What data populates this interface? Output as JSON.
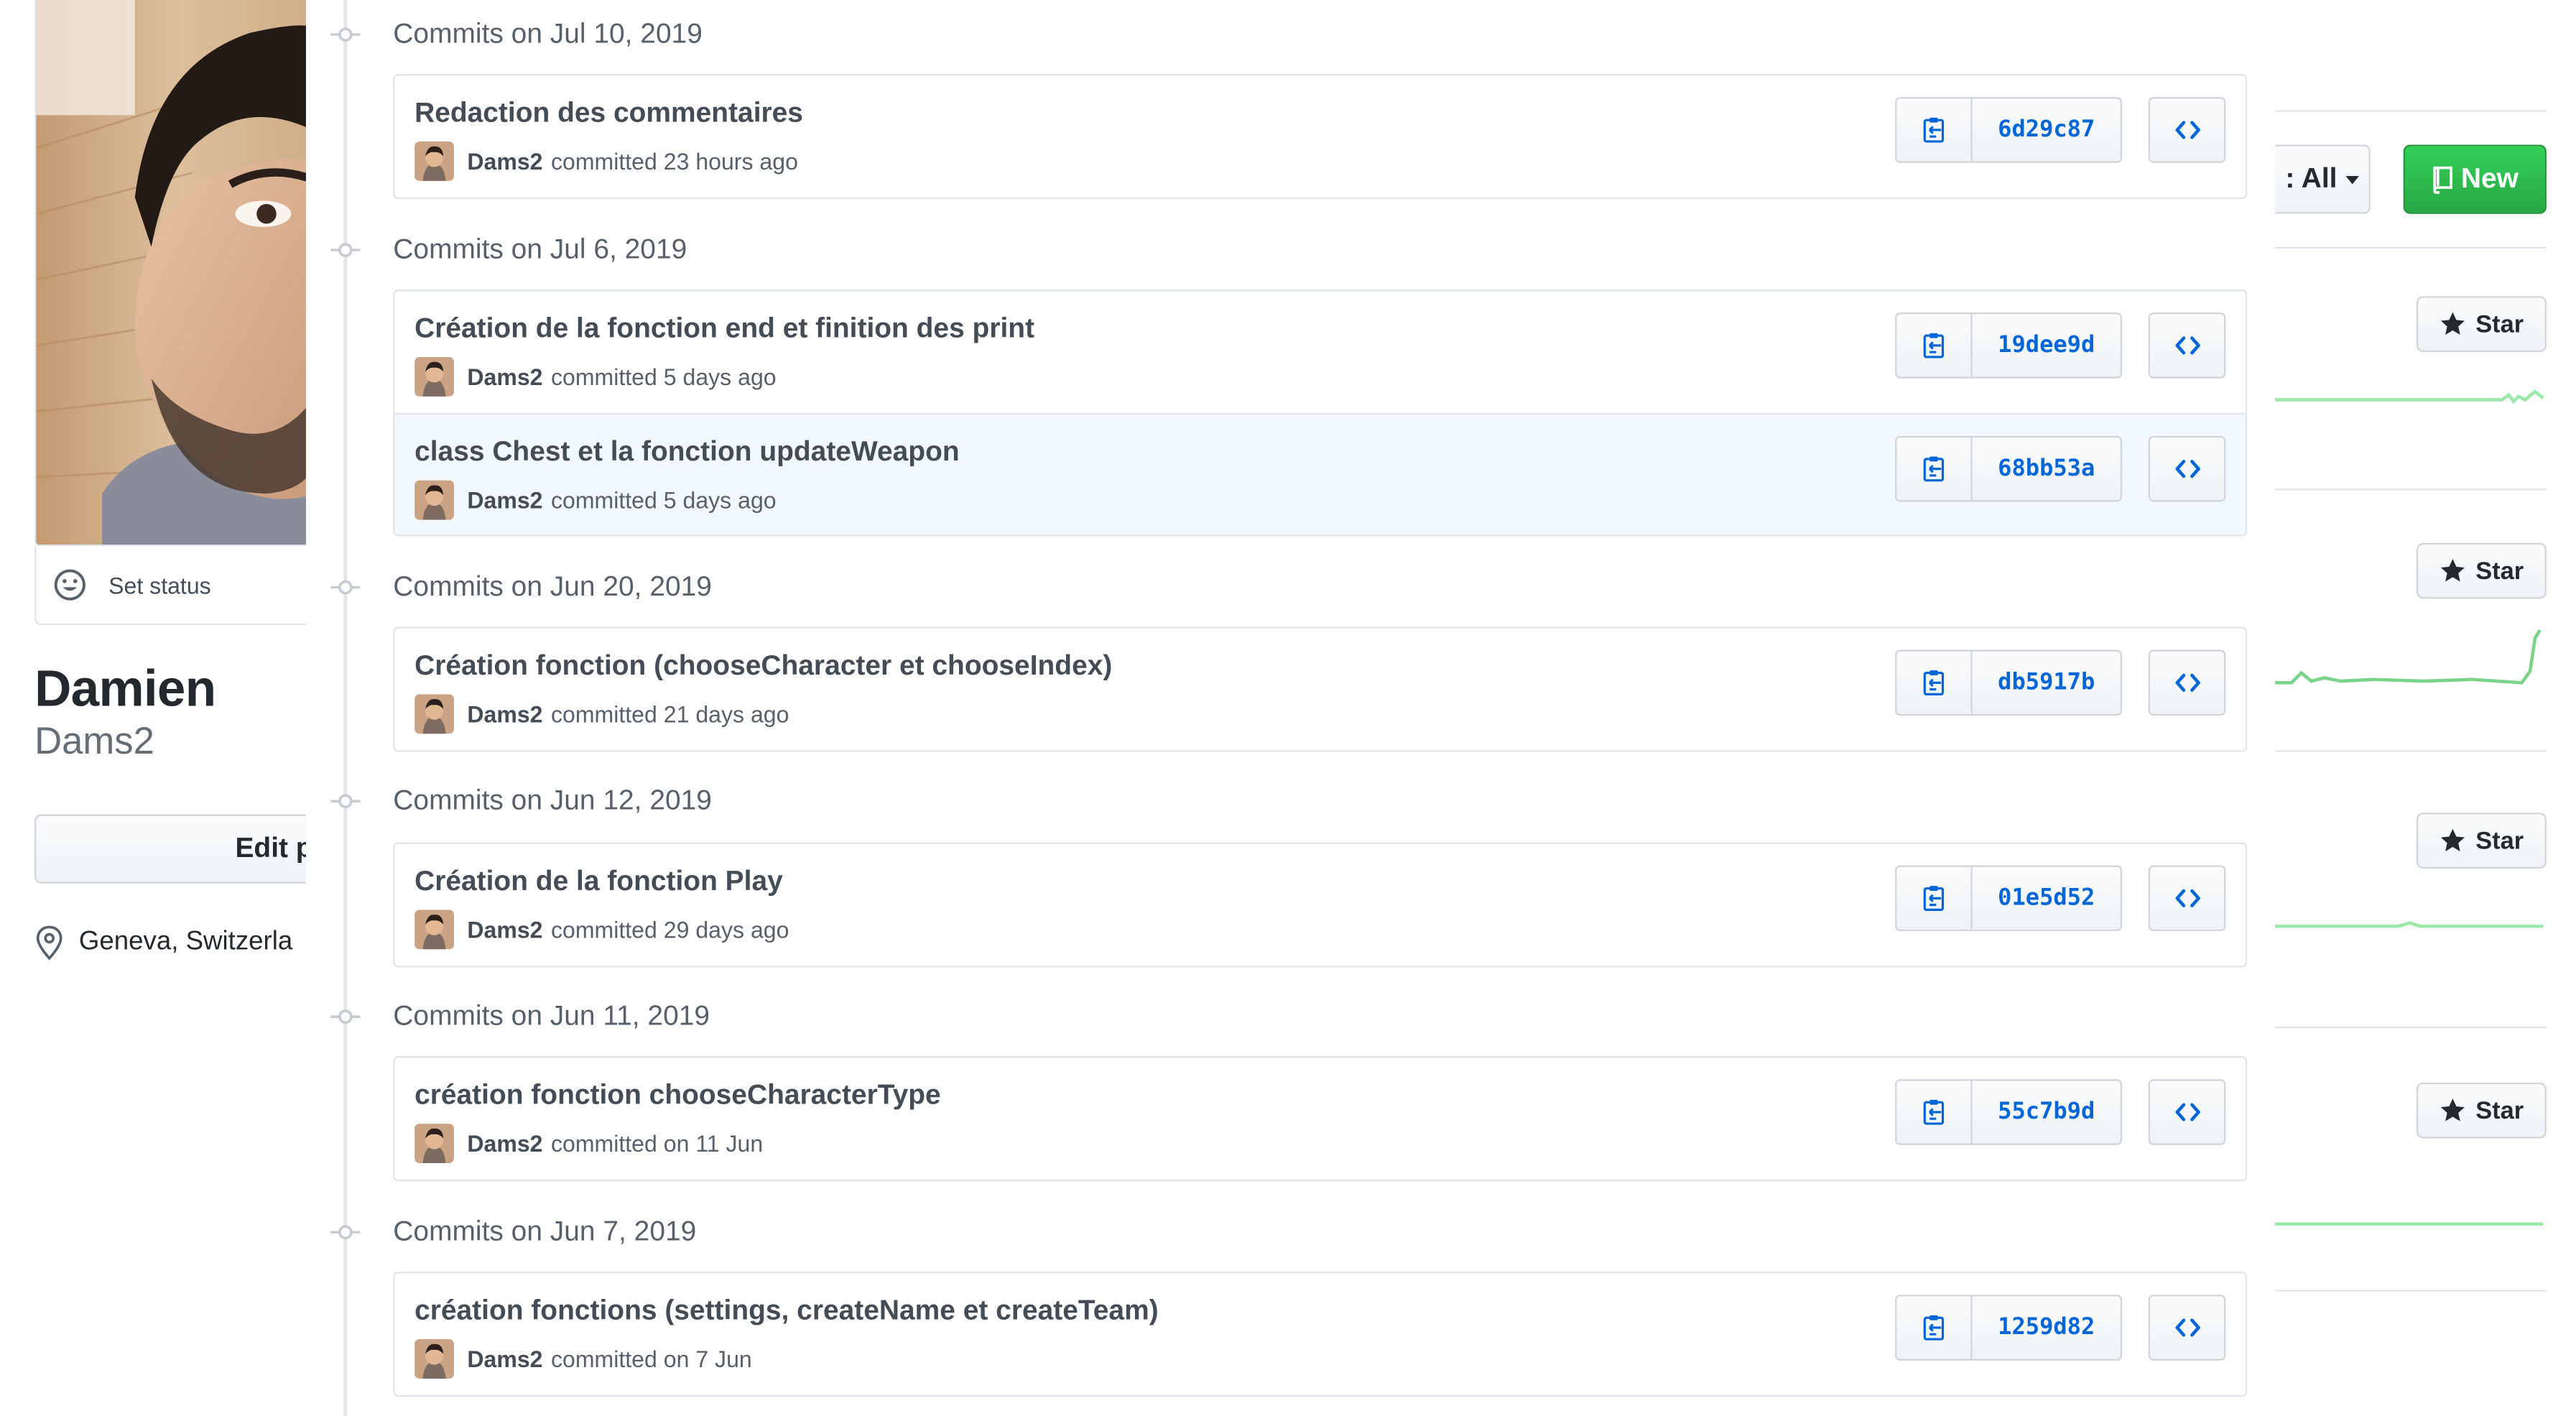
{
  "profile": {
    "status_label": "Set status",
    "name": "Damien",
    "login": "Dams2",
    "edit_label": "Edit p",
    "location": "Geneva, Switzerla"
  },
  "repos": {
    "filter_label": ": All",
    "new_label": "New",
    "star_label": "Star"
  },
  "commit_groups": [
    {
      "title": "Commits on Jul 10, 2019",
      "commits": [
        {
          "message": "Redaction des commentaires",
          "author": "Dams2",
          "meta": "committed 23 hours ago",
          "sha": "6d29c87"
        }
      ]
    },
    {
      "title": "Commits on Jul 6, 2019",
      "commits": [
        {
          "message": "Création de la fonction end et finition des print",
          "author": "Dams2",
          "meta": "committed 5 days ago",
          "sha": "19dee9d"
        },
        {
          "message": "class Chest et la fonction updateWeapon",
          "author": "Dams2",
          "meta": "committed 5 days ago",
          "sha": "68bb53a"
        }
      ]
    },
    {
      "title": "Commits on Jun 20, 2019",
      "commits": [
        {
          "message": "Création fonction (chooseCharacter et chooseIndex)",
          "author": "Dams2",
          "meta": "committed 21 days ago",
          "sha": "db5917b"
        }
      ]
    },
    {
      "title": "Commits on Jun 12, 2019",
      "commits": [
        {
          "message": "Création de la fonction Play",
          "author": "Dams2",
          "meta": "committed 29 days ago",
          "sha": "01e5d52"
        }
      ]
    },
    {
      "title": "Commits on Jun 11, 2019",
      "commits": [
        {
          "message": "création fonction chooseCharacterType",
          "author": "Dams2",
          "meta": "committed on 11 Jun",
          "sha": "55c7b9d"
        }
      ]
    },
    {
      "title": "Commits on Jun 7, 2019",
      "commits": [
        {
          "message": "création fonctions (settings, createName et createTeam)",
          "author": "Dams2",
          "meta": "committed on 7 Jun",
          "sha": "1259d82"
        }
      ]
    }
  ],
  "colors": {
    "link": "#0366d6",
    "primary_green": "#28a745",
    "spark_green": "#9be9a8",
    "spark_green_strong": "#40c463",
    "highlight_row": "#f1f8ff"
  }
}
